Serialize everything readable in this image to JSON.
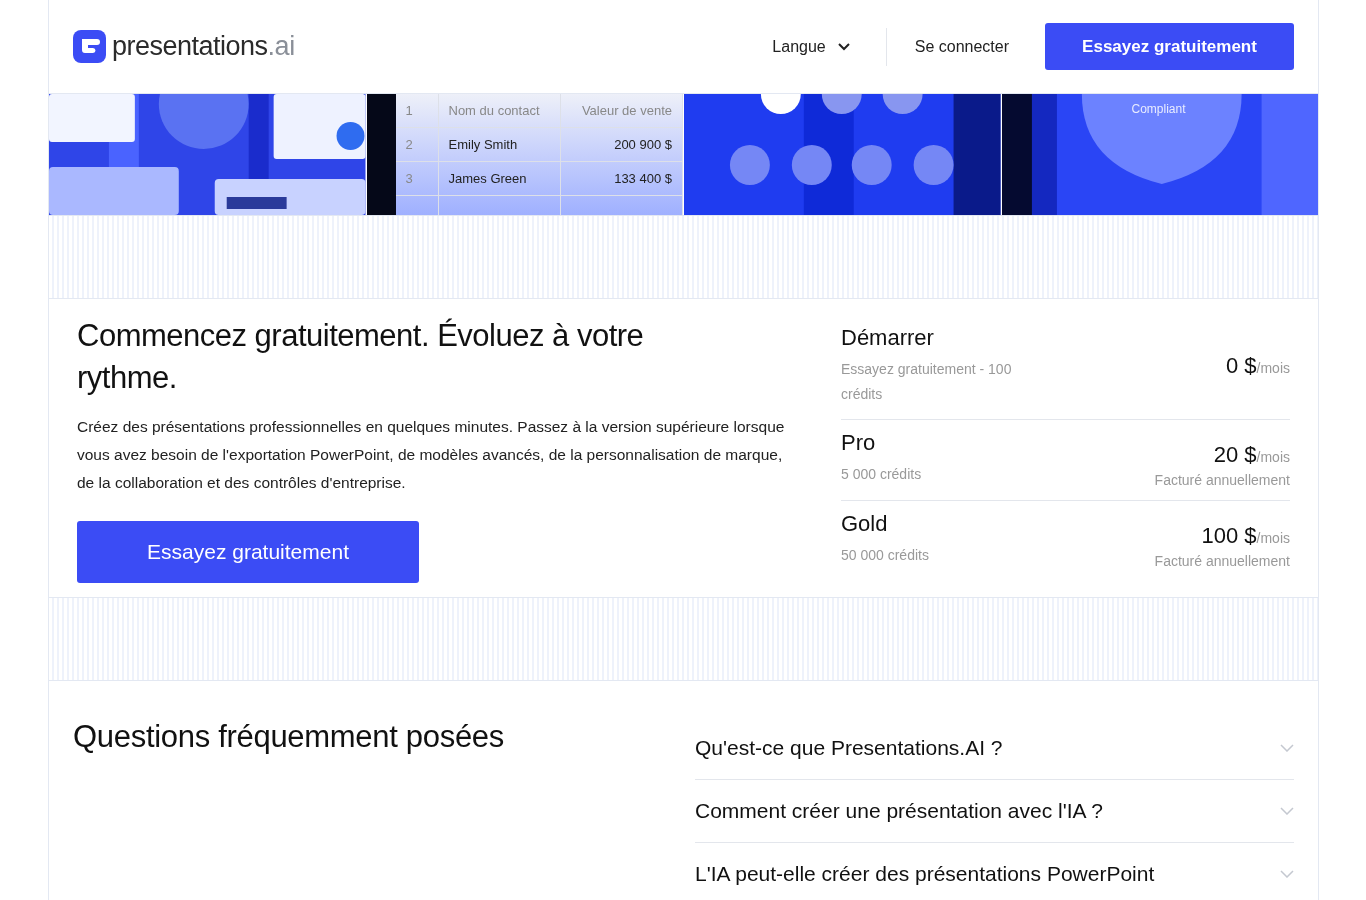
{
  "header": {
    "logo_text": "presentations",
    "logo_suffix": ".ai",
    "language": "Langue",
    "login": "Se connecter",
    "cta": "Essayez gratuitement"
  },
  "showcase": {
    "table": {
      "columns": [
        "1",
        "Nom du contact",
        "Valeur de vente"
      ],
      "rows": [
        [
          "2",
          "Emily Smith",
          "200 900 $"
        ],
        [
          "3",
          "James Green",
          "133 400 $"
        ]
      ]
    },
    "badge_caption": "Compliant"
  },
  "pricing": {
    "title": "Commencez gratuitement. Évoluez à votre rythme.",
    "description": "Créez des présentations professionnelles en quelques minutes. Passez à la version supérieure lorsque vous avez besoin de l'exportation PowerPoint, de modèles avancés, de la personnalisation de marque, de la collaboration et des contrôles d'entreprise.",
    "cta": "Essayez gratuitement",
    "plans": [
      {
        "name": "Démarrer",
        "detail": "Essayez gratuitement - 100 crédits",
        "price": "0 $",
        "unit": "/mois"
      },
      {
        "name": "Pro",
        "detail": "5 000 crédits",
        "price": "20 $",
        "unit": "/mois",
        "billing": "Facturé annuellement"
      },
      {
        "name": "Gold",
        "detail": "50 000 crédits",
        "price": "100 $",
        "unit": "/mois",
        "billing": "Facturé annuellement"
      }
    ]
  },
  "faq": {
    "title": "Questions fréquemment posées",
    "items": [
      {
        "question": "Qu'est-ce que Presentations.AI ?",
        "expanded": false
      },
      {
        "question": "Comment créer une présentation avec l'IA ?",
        "expanded": false
      },
      {
        "question": "L'IA peut-elle créer des présentations PowerPoint",
        "expanded": false
      }
    ]
  }
}
